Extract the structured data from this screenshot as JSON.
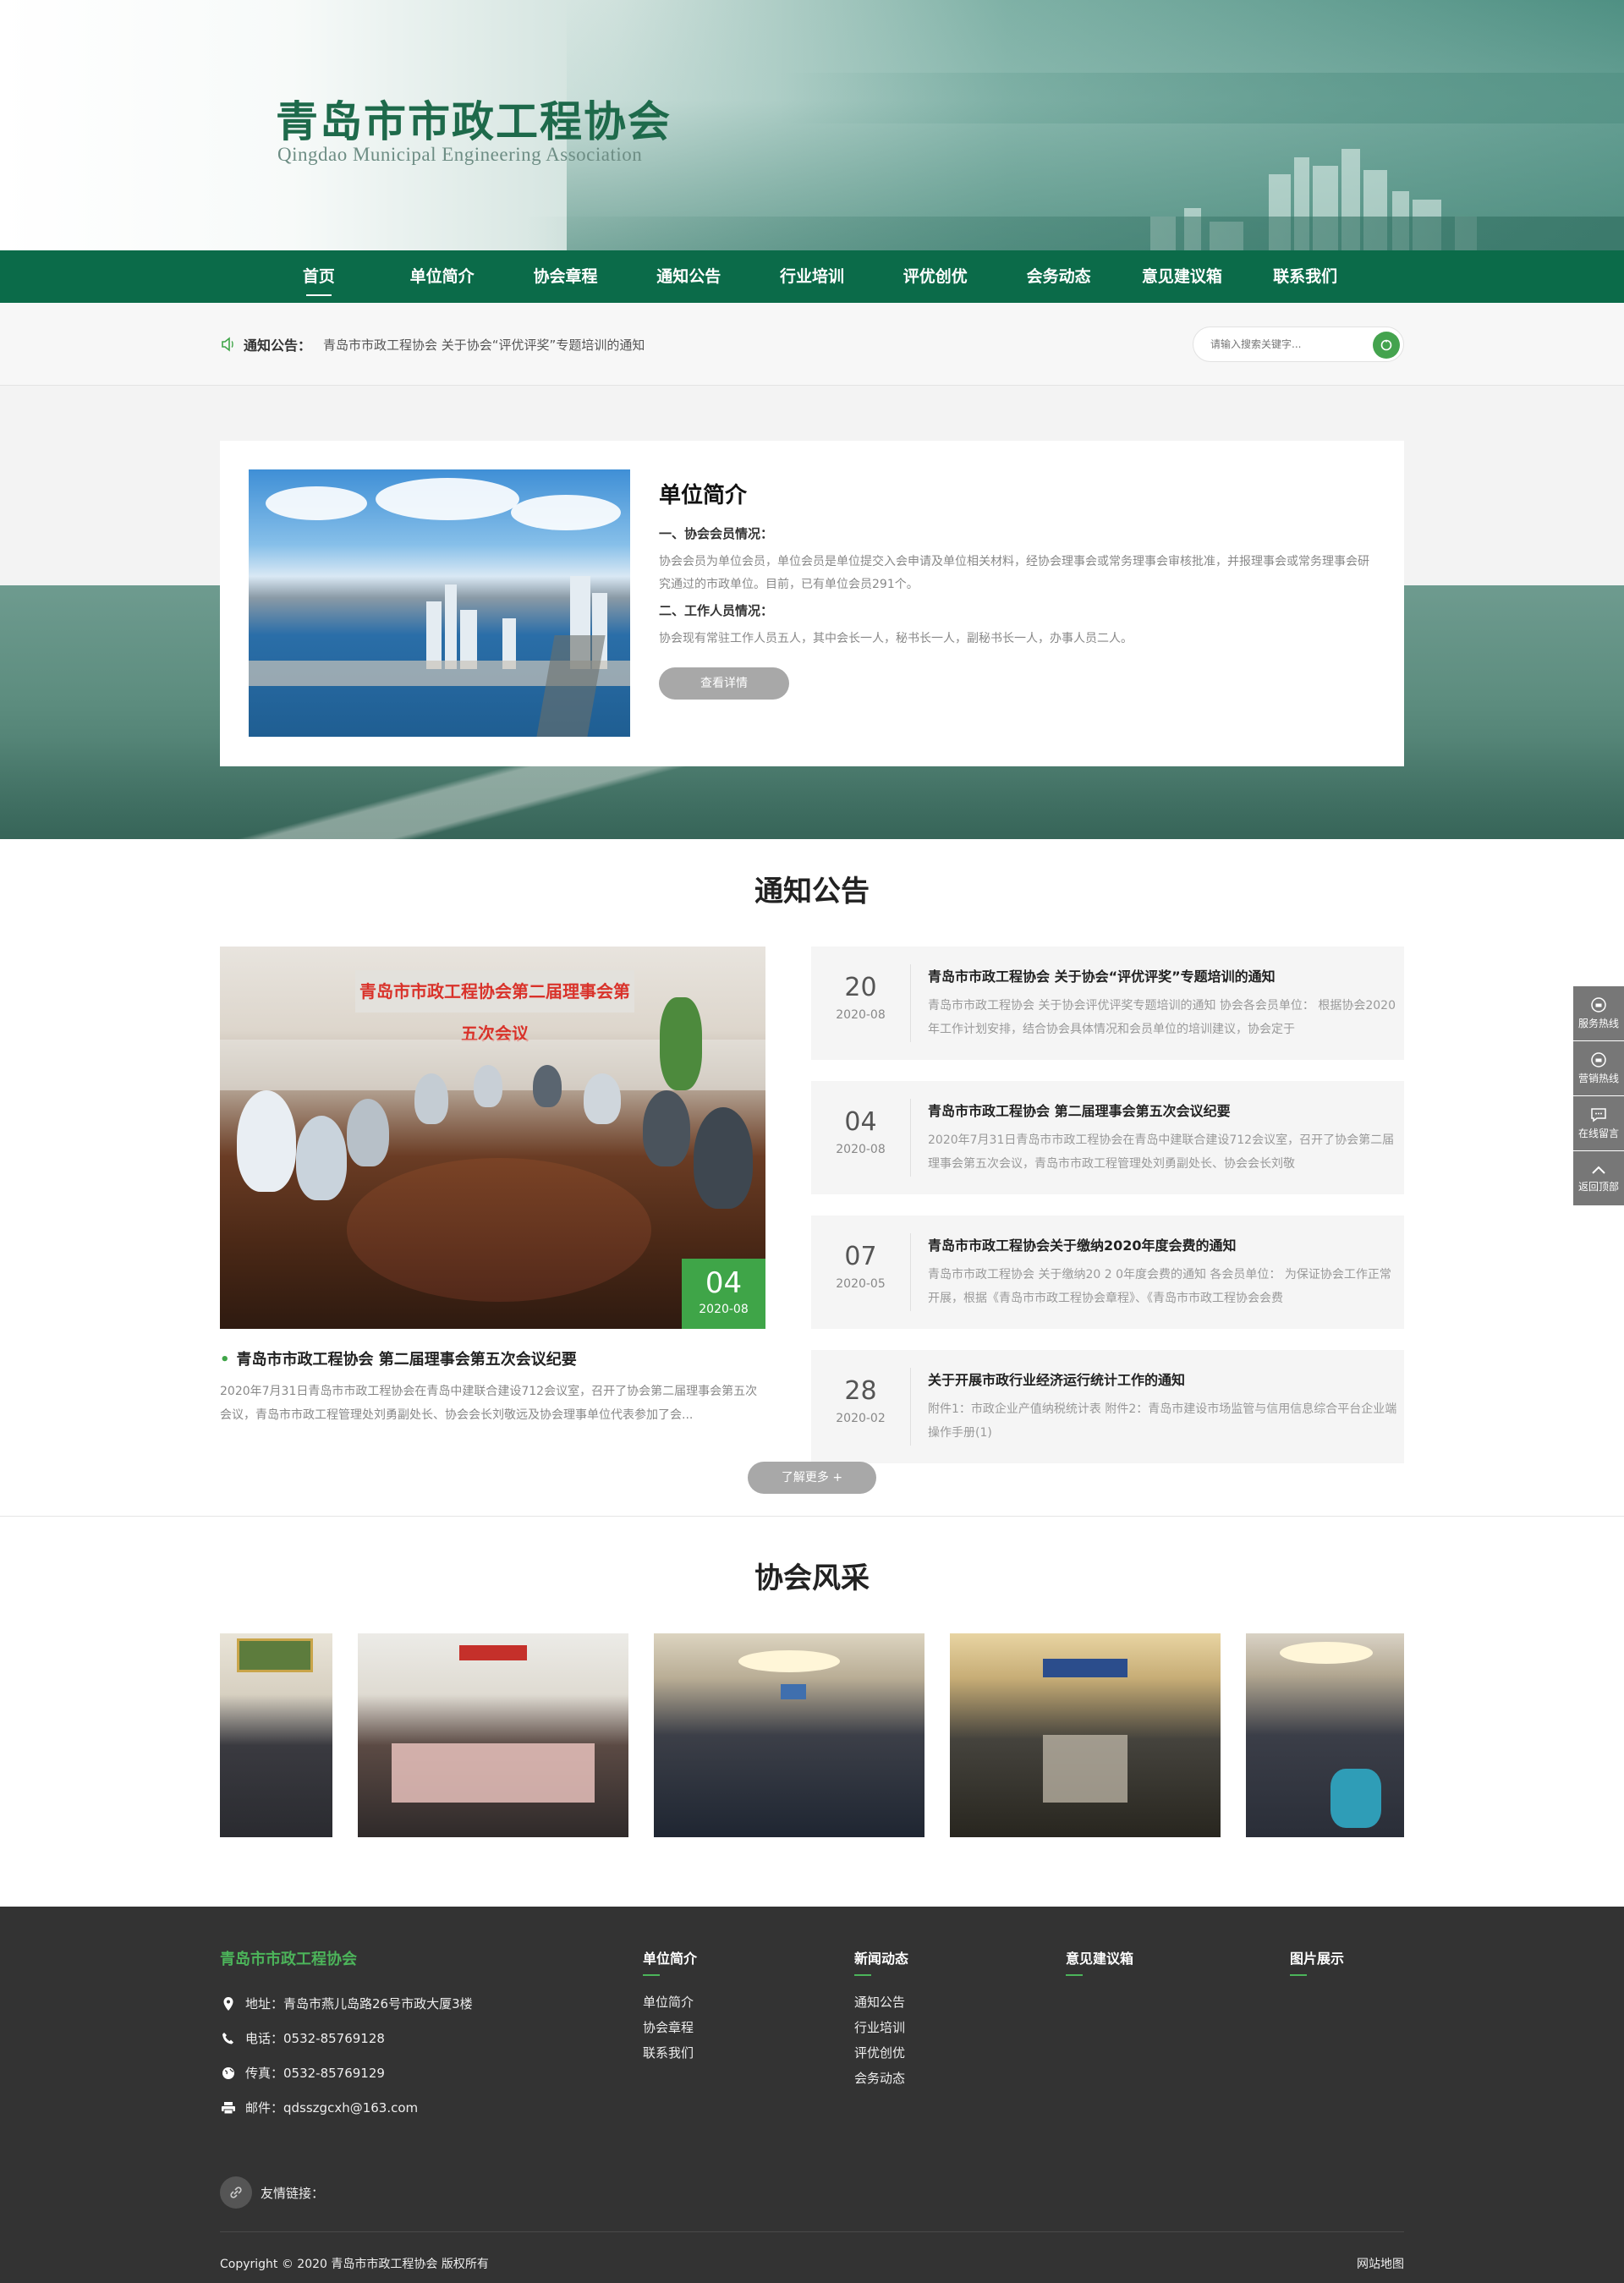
{
  "site": {
    "name_cn": "青岛市市政工程协会",
    "name_en": "Qingdao Municipal Engineering Association"
  },
  "nav": [
    {
      "label": "首页",
      "active": true
    },
    {
      "label": "单位简介"
    },
    {
      "label": "协会章程"
    },
    {
      "label": "通知公告"
    },
    {
      "label": "行业培训"
    },
    {
      "label": "评优创优"
    },
    {
      "label": "会务动态"
    },
    {
      "label": "意见建议箱"
    },
    {
      "label": "联系我们"
    }
  ],
  "notice_bar": {
    "label": "通知公告：",
    "text": "青岛市市政工程协会 关于协会“评优评奖”专题培训的通知",
    "search_placeholder": "请输入搜索关键字..."
  },
  "intro": {
    "title": "单位简介",
    "h1": "一、协会会员情况：",
    "p1": "协会会员为单位会员，单位会员是单位提交入会申请及单位相关材料，经协会理事会或常务理事会审核批准，并报理事会或常务理事会研究通过的市政单位。目前，已有单位会员291个。",
    "h2": "二、工作人员情况：",
    "p2": "协会现有常驻工作人员五人，其中会长一人，秘书长一人，副秘书长一人，办事人员二人。",
    "button": "查看详情"
  },
  "news": {
    "title": "通知公告",
    "featured": {
      "banner": "青岛市市政工程协会第二届理事会第五次会议",
      "day": "04",
      "month": "2020-08",
      "title": "青岛市市政工程协会 第二届理事会第五次会议纪要",
      "summary": "2020年7月31日青岛市市政工程协会在青岛中建联合建设712会议室，召开了协会第二届理事会第五次会议，青岛市市政工程管理处刘勇副处长、协会会长刘敬远及协会理事单位代表参加了会..."
    },
    "items": [
      {
        "day": "20",
        "month": "2020-08",
        "title": "青岛市市政工程协会 关于协会“评优评奖”专题培训的通知",
        "summary": "青岛市市政工程协会 关于协会评优评奖专题培训的通知 协会各会员单位： 根据协会2020年工作计划安排，结合协会具体情况和会员单位的培训建议，协会定于"
      },
      {
        "day": "04",
        "month": "2020-08",
        "title": "青岛市市政工程协会 第二届理事会第五次会议纪要",
        "summary": "2020年7月31日青岛市市政工程协会在青岛中建联合建设712会议室，召开了协会第二届理事会第五次会议，青岛市市政工程管理处刘勇副处长、协会会长刘敬"
      },
      {
        "day": "07",
        "month": "2020-05",
        "title": "青岛市市政工程协会关于缴纳2020年度会费的通知",
        "summary": "青岛市市政工程协会 关于缴纳20 2 0年度会费的通知 各会员单位： 为保证协会工作正常开展，根据《青岛市市政工程协会章程》、《青岛市市政工程协会会费"
      },
      {
        "day": "28",
        "month": "2020-02",
        "title": "关于开展市政行业经济运行统计工作的通知",
        "summary": "附件1：市政企业产值纳税统计表 附件2：青岛市建设市场监管与信用信息综合平台企业端操作手册(1)"
      }
    ],
    "more": "了解更多 +"
  },
  "gallery": {
    "title": "协会风采"
  },
  "footer": {
    "name": "青岛市市政工程协会",
    "address": "地址：青岛市燕儿岛路26号市政大厦3楼",
    "phone": "电话：0532-85769128",
    "fax": "传真：0532-85769129",
    "email": "邮件：qdsszgcxh@163.com",
    "cols": [
      {
        "title": "单位简介",
        "links": [
          "单位简介",
          "协会章程",
          "联系我们"
        ]
      },
      {
        "title": "新闻动态",
        "links": [
          "通知公告",
          "行业培训",
          "评优创优",
          "会务动态"
        ]
      },
      {
        "title": "意见建议箱",
        "links": []
      },
      {
        "title": "图片展示",
        "links": []
      }
    ],
    "friend_links": "友情链接：",
    "copyright": "Copyright © 2020 青岛市市政工程协会 版权所有",
    "sitemap": "网站地图"
  },
  "sidebar": [
    {
      "label": "服务热线",
      "icon": "phone-icon"
    },
    {
      "label": "营销热线",
      "icon": "phone-icon"
    },
    {
      "label": "在线留言",
      "icon": "message-icon"
    },
    {
      "label": "返回顶部",
      "icon": "chevron-up-icon"
    }
  ],
  "colors": {
    "brand": "#0b6b49",
    "accent": "#3fa548",
    "footer": "#333333"
  }
}
